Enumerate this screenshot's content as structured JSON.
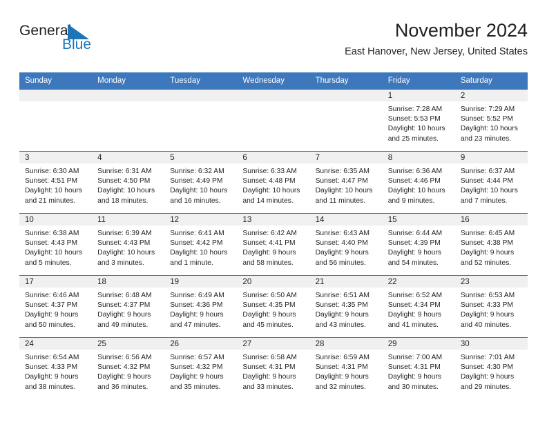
{
  "brand": {
    "name_part1": "General",
    "name_part2": "Blue",
    "triangle_icon": "triangle-logo-icon",
    "accent_color": "#1b75bb"
  },
  "header": {
    "title": "November 2024",
    "subtitle": "East Hanover, New Jersey, United States"
  },
  "theme": {
    "header_blue": "#3d77bc",
    "band_gray": "#f0f0f0",
    "text": "#231f20"
  },
  "weekday_headers": [
    "Sunday",
    "Monday",
    "Tuesday",
    "Wednesday",
    "Thursday",
    "Friday",
    "Saturday"
  ],
  "labels": {
    "sunrise_prefix": "Sunrise:",
    "sunset_prefix": "Sunset:",
    "daylight_prefix": "Daylight:"
  },
  "weeks": [
    [
      {
        "day": "",
        "sunrise": "",
        "sunset": "",
        "daylight_line1": "",
        "daylight_line2": ""
      },
      {
        "day": "",
        "sunrise": "",
        "sunset": "",
        "daylight_line1": "",
        "daylight_line2": ""
      },
      {
        "day": "",
        "sunrise": "",
        "sunset": "",
        "daylight_line1": "",
        "daylight_line2": ""
      },
      {
        "day": "",
        "sunrise": "",
        "sunset": "",
        "daylight_line1": "",
        "daylight_line2": ""
      },
      {
        "day": "",
        "sunrise": "",
        "sunset": "",
        "daylight_line1": "",
        "daylight_line2": ""
      },
      {
        "day": "1",
        "sunrise": "Sunrise: 7:28 AM",
        "sunset": "Sunset: 5:53 PM",
        "daylight_line1": "Daylight: 10 hours",
        "daylight_line2": "and 25 minutes."
      },
      {
        "day": "2",
        "sunrise": "Sunrise: 7:29 AM",
        "sunset": "Sunset: 5:52 PM",
        "daylight_line1": "Daylight: 10 hours",
        "daylight_line2": "and 23 minutes."
      }
    ],
    [
      {
        "day": "3",
        "sunrise": "Sunrise: 6:30 AM",
        "sunset": "Sunset: 4:51 PM",
        "daylight_line1": "Daylight: 10 hours",
        "daylight_line2": "and 21 minutes."
      },
      {
        "day": "4",
        "sunrise": "Sunrise: 6:31 AM",
        "sunset": "Sunset: 4:50 PM",
        "daylight_line1": "Daylight: 10 hours",
        "daylight_line2": "and 18 minutes."
      },
      {
        "day": "5",
        "sunrise": "Sunrise: 6:32 AM",
        "sunset": "Sunset: 4:49 PM",
        "daylight_line1": "Daylight: 10 hours",
        "daylight_line2": "and 16 minutes."
      },
      {
        "day": "6",
        "sunrise": "Sunrise: 6:33 AM",
        "sunset": "Sunset: 4:48 PM",
        "daylight_line1": "Daylight: 10 hours",
        "daylight_line2": "and 14 minutes."
      },
      {
        "day": "7",
        "sunrise": "Sunrise: 6:35 AM",
        "sunset": "Sunset: 4:47 PM",
        "daylight_line1": "Daylight: 10 hours",
        "daylight_line2": "and 11 minutes."
      },
      {
        "day": "8",
        "sunrise": "Sunrise: 6:36 AM",
        "sunset": "Sunset: 4:46 PM",
        "daylight_line1": "Daylight: 10 hours",
        "daylight_line2": "and 9 minutes."
      },
      {
        "day": "9",
        "sunrise": "Sunrise: 6:37 AM",
        "sunset": "Sunset: 4:44 PM",
        "daylight_line1": "Daylight: 10 hours",
        "daylight_line2": "and 7 minutes."
      }
    ],
    [
      {
        "day": "10",
        "sunrise": "Sunrise: 6:38 AM",
        "sunset": "Sunset: 4:43 PM",
        "daylight_line1": "Daylight: 10 hours",
        "daylight_line2": "and 5 minutes."
      },
      {
        "day": "11",
        "sunrise": "Sunrise: 6:39 AM",
        "sunset": "Sunset: 4:43 PM",
        "daylight_line1": "Daylight: 10 hours",
        "daylight_line2": "and 3 minutes."
      },
      {
        "day": "12",
        "sunrise": "Sunrise: 6:41 AM",
        "sunset": "Sunset: 4:42 PM",
        "daylight_line1": "Daylight: 10 hours",
        "daylight_line2": "and 1 minute."
      },
      {
        "day": "13",
        "sunrise": "Sunrise: 6:42 AM",
        "sunset": "Sunset: 4:41 PM",
        "daylight_line1": "Daylight: 9 hours",
        "daylight_line2": "and 58 minutes."
      },
      {
        "day": "14",
        "sunrise": "Sunrise: 6:43 AM",
        "sunset": "Sunset: 4:40 PM",
        "daylight_line1": "Daylight: 9 hours",
        "daylight_line2": "and 56 minutes."
      },
      {
        "day": "15",
        "sunrise": "Sunrise: 6:44 AM",
        "sunset": "Sunset: 4:39 PM",
        "daylight_line1": "Daylight: 9 hours",
        "daylight_line2": "and 54 minutes."
      },
      {
        "day": "16",
        "sunrise": "Sunrise: 6:45 AM",
        "sunset": "Sunset: 4:38 PM",
        "daylight_line1": "Daylight: 9 hours",
        "daylight_line2": "and 52 minutes."
      }
    ],
    [
      {
        "day": "17",
        "sunrise": "Sunrise: 6:46 AM",
        "sunset": "Sunset: 4:37 PM",
        "daylight_line1": "Daylight: 9 hours",
        "daylight_line2": "and 50 minutes."
      },
      {
        "day": "18",
        "sunrise": "Sunrise: 6:48 AM",
        "sunset": "Sunset: 4:37 PM",
        "daylight_line1": "Daylight: 9 hours",
        "daylight_line2": "and 49 minutes."
      },
      {
        "day": "19",
        "sunrise": "Sunrise: 6:49 AM",
        "sunset": "Sunset: 4:36 PM",
        "daylight_line1": "Daylight: 9 hours",
        "daylight_line2": "and 47 minutes."
      },
      {
        "day": "20",
        "sunrise": "Sunrise: 6:50 AM",
        "sunset": "Sunset: 4:35 PM",
        "daylight_line1": "Daylight: 9 hours",
        "daylight_line2": "and 45 minutes."
      },
      {
        "day": "21",
        "sunrise": "Sunrise: 6:51 AM",
        "sunset": "Sunset: 4:35 PM",
        "daylight_line1": "Daylight: 9 hours",
        "daylight_line2": "and 43 minutes."
      },
      {
        "day": "22",
        "sunrise": "Sunrise: 6:52 AM",
        "sunset": "Sunset: 4:34 PM",
        "daylight_line1": "Daylight: 9 hours",
        "daylight_line2": "and 41 minutes."
      },
      {
        "day": "23",
        "sunrise": "Sunrise: 6:53 AM",
        "sunset": "Sunset: 4:33 PM",
        "daylight_line1": "Daylight: 9 hours",
        "daylight_line2": "and 40 minutes."
      }
    ],
    [
      {
        "day": "24",
        "sunrise": "Sunrise: 6:54 AM",
        "sunset": "Sunset: 4:33 PM",
        "daylight_line1": "Daylight: 9 hours",
        "daylight_line2": "and 38 minutes."
      },
      {
        "day": "25",
        "sunrise": "Sunrise: 6:56 AM",
        "sunset": "Sunset: 4:32 PM",
        "daylight_line1": "Daylight: 9 hours",
        "daylight_line2": "and 36 minutes."
      },
      {
        "day": "26",
        "sunrise": "Sunrise: 6:57 AM",
        "sunset": "Sunset: 4:32 PM",
        "daylight_line1": "Daylight: 9 hours",
        "daylight_line2": "and 35 minutes."
      },
      {
        "day": "27",
        "sunrise": "Sunrise: 6:58 AM",
        "sunset": "Sunset: 4:31 PM",
        "daylight_line1": "Daylight: 9 hours",
        "daylight_line2": "and 33 minutes."
      },
      {
        "day": "28",
        "sunrise": "Sunrise: 6:59 AM",
        "sunset": "Sunset: 4:31 PM",
        "daylight_line1": "Daylight: 9 hours",
        "daylight_line2": "and 32 minutes."
      },
      {
        "day": "29",
        "sunrise": "Sunrise: 7:00 AM",
        "sunset": "Sunset: 4:31 PM",
        "daylight_line1": "Daylight: 9 hours",
        "daylight_line2": "and 30 minutes."
      },
      {
        "day": "30",
        "sunrise": "Sunrise: 7:01 AM",
        "sunset": "Sunset: 4:30 PM",
        "daylight_line1": "Daylight: 9 hours",
        "daylight_line2": "and 29 minutes."
      }
    ]
  ]
}
